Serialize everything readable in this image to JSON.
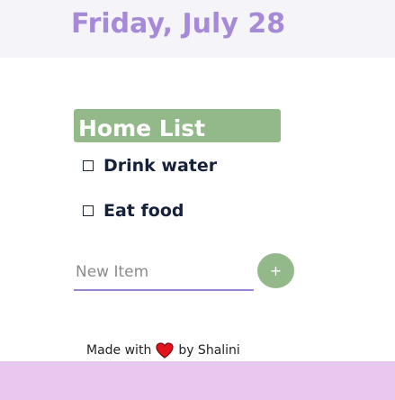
{
  "header": {
    "date": "Friday, July 28"
  },
  "list": {
    "title": "Home List",
    "items": [
      {
        "label": "Drink water",
        "checked": false
      },
      {
        "label": "Eat food",
        "checked": false
      }
    ]
  },
  "new_item": {
    "placeholder": "New Item",
    "value": "",
    "add_label": "+"
  },
  "footer": {
    "prefix": "Made with",
    "icon": "heart-icon",
    "suffix": "by Shalini"
  },
  "colors": {
    "date_text": "#a68ad8",
    "list_header": "#93b98b",
    "input_underline": "#9b84d6",
    "add_button": "#93b98b",
    "heart": "#e1141e",
    "footer_bar": "#e8c8ee",
    "header_bar": "#f5f4f8"
  }
}
